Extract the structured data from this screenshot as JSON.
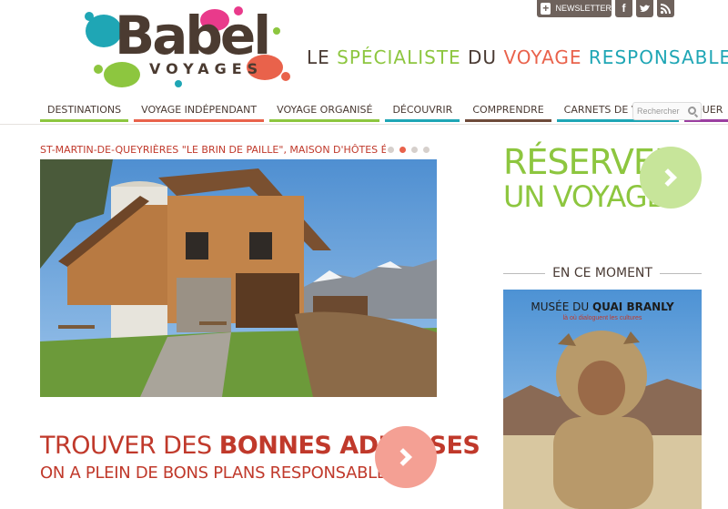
{
  "header": {
    "newsletter_label": "NEWSLETTER",
    "social": [
      {
        "name": "facebook-icon",
        "glyph": "f"
      },
      {
        "name": "twitter-icon",
        "glyph": "t"
      },
      {
        "name": "rss-icon",
        "glyph": "◥"
      }
    ],
    "logo_main": "Babel",
    "logo_sub": "VOYAGES",
    "tagline": {
      "w1": "LE ",
      "w2": "SPÉCIALISTE",
      "w3": " DU ",
      "w4": "VOYAGE",
      "w5": " RESPONSABLE"
    }
  },
  "nav": {
    "items": [
      {
        "label": "DESTINATIONS",
        "color": "#8dc63f"
      },
      {
        "label": "VOYAGE INDÉPENDANT",
        "color": "#e9624b"
      },
      {
        "label": "VOYAGE ORGANISÉ",
        "color": "#8dc63f"
      },
      {
        "label": "DÉCOUVRIR",
        "color": "#1fa6b5"
      },
      {
        "label": "COMPRENDRE",
        "color": "#6e4a3a"
      },
      {
        "label": "CARNETS DE VOYAGE",
        "color": "#1fa6b5"
      },
      {
        "label": "JOUER",
        "color": "#9b3fa0"
      }
    ],
    "search_placeholder": "Rechercher"
  },
  "slider": {
    "caption": "ST-MARTIN-DE-QUEYRIÈRES \"LE BRIN DE PAILLE\", MAISON D'HÔTES ÉCOLOGIQUE EN PLEIN",
    "dot_count": 4,
    "active_dot": 2
  },
  "cta": {
    "title_a": "TROUVER DES ",
    "title_b": "BONNES ADRESSES",
    "subtitle": "ON A PLEIN DE BONS PLANS RESPONSABLES"
  },
  "sidebar": {
    "reserve_line1": "RÉSERVER",
    "reserve_line2": "UN VOYAGE",
    "moment_label": "EN CE MOMENT",
    "ad_title_a": "MUSÉE DU ",
    "ad_title_b": "QUAI BRANLY",
    "ad_subtitle": "là où dialoguent les cultures"
  },
  "colors": {
    "green": "#8dc63f",
    "red": "#c0392b",
    "orange": "#e9624b",
    "cyan": "#1fa6b5",
    "brown": "#4b3b31",
    "salmon": "#f4a094",
    "lightgreen": "#c7e59a"
  }
}
